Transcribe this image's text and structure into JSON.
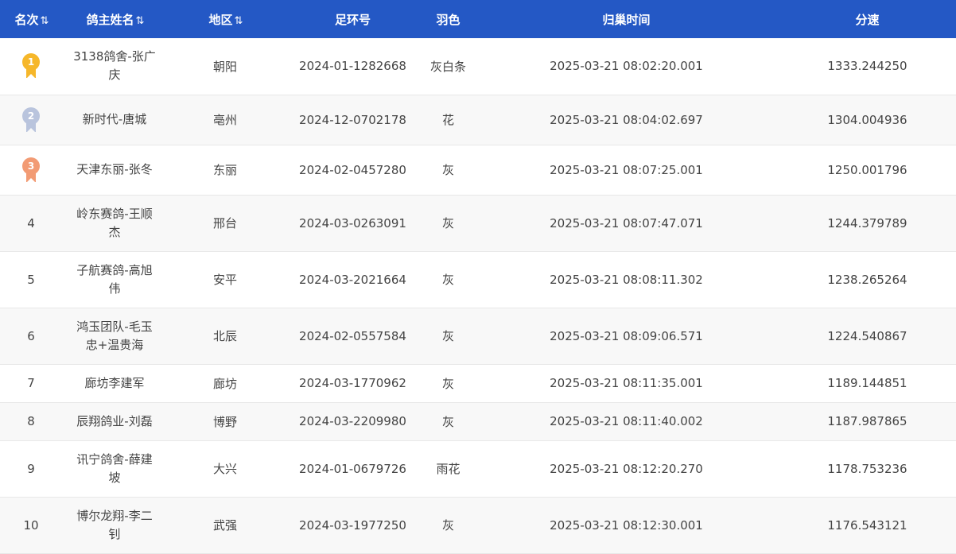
{
  "headers": {
    "rank": "名次",
    "owner": "鸽主姓名",
    "region": "地区",
    "ring": "足环号",
    "color": "羽色",
    "time": "归巢时间",
    "speed": "分速",
    "sort_icon": "⇅"
  },
  "medals": {
    "gold": "#f6b72a",
    "silver": "#b9c4dd",
    "bronze": "#f29b74"
  },
  "rows": [
    {
      "rank": "1",
      "owner": "3138鸽舍-张广庆",
      "region": "朝阳",
      "ring": "2024-01-1282668",
      "color": "灰白条",
      "time": "2025-03-21 08:02:20.001",
      "speed": "1333.244250"
    },
    {
      "rank": "2",
      "owner": "新时代-唐城",
      "region": "亳州",
      "ring": "2024-12-0702178",
      "color": "花",
      "time": "2025-03-21 08:04:02.697",
      "speed": "1304.004936"
    },
    {
      "rank": "3",
      "owner": "天津东丽-张冬",
      "region": "东丽",
      "ring": "2024-02-0457280",
      "color": "灰",
      "time": "2025-03-21 08:07:25.001",
      "speed": "1250.001796"
    },
    {
      "rank": "4",
      "owner": "岭东赛鸽-王顺杰",
      "region": "邢台",
      "ring": "2024-03-0263091",
      "color": "灰",
      "time": "2025-03-21 08:07:47.071",
      "speed": "1244.379789"
    },
    {
      "rank": "5",
      "owner": "子航赛鸽-高旭伟",
      "region": "安平",
      "ring": "2024-03-2021664",
      "color": "灰",
      "time": "2025-03-21 08:08:11.302",
      "speed": "1238.265264"
    },
    {
      "rank": "6",
      "owner": "鸿玉团队-毛玉忠+温贵海",
      "region": "北辰",
      "ring": "2024-02-0557584",
      "color": "灰",
      "time": "2025-03-21 08:09:06.571",
      "speed": "1224.540867"
    },
    {
      "rank": "7",
      "owner": "廊坊李建军",
      "region": "廊坊",
      "ring": "2024-03-1770962",
      "color": "灰",
      "time": "2025-03-21 08:11:35.001",
      "speed": "1189.144851"
    },
    {
      "rank": "8",
      "owner": "辰翔鸽业-刘磊",
      "region": "博野",
      "ring": "2024-03-2209980",
      "color": "灰",
      "time": "2025-03-21 08:11:40.002",
      "speed": "1187.987865"
    },
    {
      "rank": "9",
      "owner": "讯宁鸽舍-薛建坡",
      "region": "大兴",
      "ring": "2024-01-0679726",
      "color": "雨花",
      "time": "2025-03-21 08:12:20.270",
      "speed": "1178.753236"
    },
    {
      "rank": "10",
      "owner": "博尔龙翔-李二钊",
      "region": "武强",
      "ring": "2024-03-1977250",
      "color": "灰",
      "time": "2025-03-21 08:12:30.001",
      "speed": "1176.543121"
    }
  ]
}
